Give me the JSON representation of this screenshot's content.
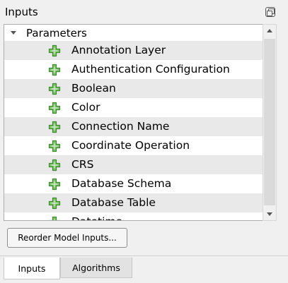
{
  "panel": {
    "title": "Inputs"
  },
  "tree": {
    "root_label": "Parameters",
    "items": [
      {
        "label": "Annotation Layer"
      },
      {
        "label": "Authentication Configuration"
      },
      {
        "label": "Boolean"
      },
      {
        "label": "Color"
      },
      {
        "label": "Connection Name"
      },
      {
        "label": "Coordinate Operation"
      },
      {
        "label": "CRS"
      },
      {
        "label": "Database Schema"
      },
      {
        "label": "Database Table"
      },
      {
        "label": "Datetime"
      }
    ]
  },
  "buttons": {
    "reorder_label": "Reorder Model Inputs..."
  },
  "tabs": [
    {
      "label": "Inputs",
      "active": true
    },
    {
      "label": "Algorithms",
      "active": false
    }
  ],
  "icons": {
    "item_icon": "green-plus-icon",
    "float_icon": "float-panel-icon",
    "expand_icon": "expand-arrow-icon"
  },
  "colors": {
    "plus_fill": "#7cc36b",
    "plus_stroke": "#3f8a2e",
    "alt_row": "#e9e9e9"
  }
}
